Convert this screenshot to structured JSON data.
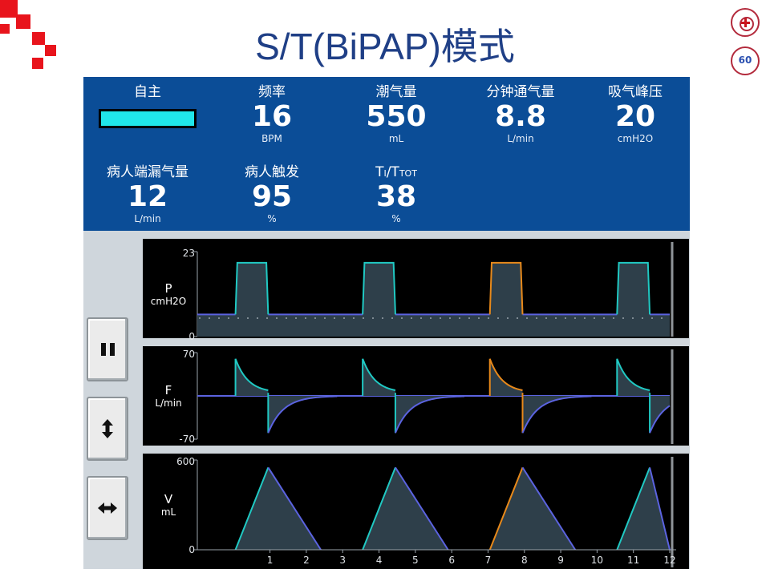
{
  "page": {
    "title": "S/T(BiPAP)模式"
  },
  "colors": {
    "inspiration": "#20c9c3",
    "expiration": "#5b63e0",
    "triggered": "#e8891a",
    "fill": "#2e3f4a",
    "panel": "#0b4d97"
  },
  "monitor": {
    "mode_label": "自主",
    "row1": [
      {
        "label": "频率",
        "value": "16",
        "unit": "BPM"
      },
      {
        "label": "潮气量",
        "value": "550",
        "unit": "mL"
      },
      {
        "label": "分钟通气量",
        "value": "8.8",
        "unit": "L/min"
      },
      {
        "label": "吸气峰压",
        "value": "20",
        "unit": "cmH2O"
      }
    ],
    "row2": [
      {
        "label": "病人端漏气量",
        "value": "12",
        "unit": "L/min"
      },
      {
        "label": "病人触发",
        "value": "95",
        "unit": "%"
      },
      {
        "label_parts": [
          "T",
          "I",
          "/T",
          "TOT"
        ],
        "value": "38",
        "unit": "%"
      }
    ]
  },
  "buttons": [
    {
      "name": "pause",
      "icon": "pause-icon"
    },
    {
      "name": "vertical-scale",
      "icon": "vertical-arrows-icon"
    },
    {
      "name": "horizontal-scale",
      "icon": "horizontal-arrows-icon"
    }
  ],
  "chart_data": [
    {
      "type": "line",
      "ylabel": "P",
      "yunit": "cmH2O",
      "ylim": [
        0,
        23
      ],
      "ytick_labels": [
        "23",
        "0"
      ],
      "x_ticks": [
        "1",
        "2",
        "3",
        "4",
        "5",
        "6",
        "7",
        "8",
        "9",
        "10",
        "11",
        "12"
      ],
      "xlim": [
        -1,
        12
      ],
      "breaths": [
        {
          "start": 0.05,
          "duration": 0.9,
          "color": "inspiration"
        },
        {
          "start": 3.55,
          "duration": 0.9,
          "color": "inspiration"
        },
        {
          "start": 7.05,
          "duration": 0.9,
          "color": "triggered"
        },
        {
          "start": 10.55,
          "duration": 0.9,
          "color": "inspiration"
        }
      ],
      "ipap": 20,
      "epap": 6,
      "baseline_dotted": 5
    },
    {
      "type": "line",
      "ylabel": "F",
      "yunit": "L/min",
      "ylim": [
        -70,
        70
      ],
      "ytick_labels": [
        "70",
        "-70"
      ],
      "x_ticks": [
        "1",
        "2",
        "3",
        "4",
        "5",
        "6",
        "7",
        "8",
        "9",
        "10",
        "11",
        "12"
      ],
      "xlim": [
        -1,
        12
      ],
      "peak_insp": 60,
      "insp_end": 5,
      "peak_exp": -60
    },
    {
      "type": "line",
      "ylabel": "V",
      "yunit": "mL",
      "ylim": [
        0,
        600
      ],
      "ytick_labels": [
        "600",
        "0"
      ],
      "x_ticks": [
        "1",
        "2",
        "3",
        "4",
        "5",
        "6",
        "7",
        "8",
        "9",
        "10",
        "11",
        "12"
      ],
      "xlim": [
        -1,
        12
      ],
      "peak_volume": 550
    }
  ]
}
